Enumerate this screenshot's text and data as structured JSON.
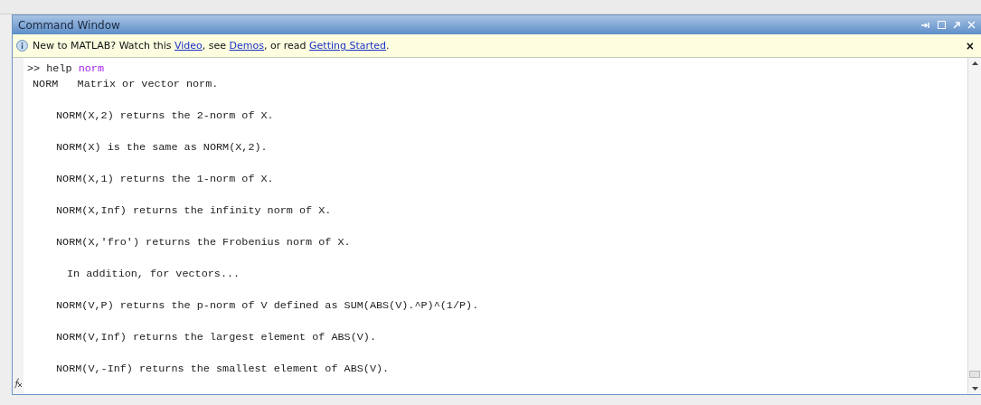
{
  "window": {
    "title": "Command Window"
  },
  "info_bar": {
    "parts": [
      {
        "kind": "text",
        "text": "New to MATLAB? Watch this "
      },
      {
        "kind": "link",
        "text": "Video"
      },
      {
        "kind": "text",
        "text": ", see "
      },
      {
        "kind": "link",
        "text": "Demos"
      },
      {
        "kind": "text",
        "text": ", or read "
      },
      {
        "kind": "link",
        "text": "Getting Started"
      },
      {
        "kind": "text",
        "text": "."
      }
    ],
    "close": "×"
  },
  "command": {
    "prompt": ">>",
    "name": "help",
    "argument": "norm"
  },
  "output": [
    {
      "kind": "heading",
      "text": "NORM   Matrix or vector norm."
    },
    {
      "kind": "body",
      "text": "NORM(X,2) returns the 2-norm of X."
    },
    {
      "kind": "body",
      "text": "NORM(X) is the same as NORM(X,2)."
    },
    {
      "kind": "body",
      "text": "NORM(X,1) returns the 1-norm of X."
    },
    {
      "kind": "body",
      "text": "NORM(X,Inf) returns the infinity norm of X."
    },
    {
      "kind": "body",
      "text": "NORM(X,'fro') returns the Frobenius norm of X."
    },
    {
      "kind": "section",
      "text": "In addition, for vectors..."
    },
    {
      "kind": "body",
      "text": "NORM(V,P) returns the p-norm of V defined as SUM(ABS(V).^P)^(1/P)."
    },
    {
      "kind": "body",
      "text": "NORM(V,Inf) returns the largest element of ABS(V)."
    },
    {
      "kind": "body",
      "text": "NORM(V,-Inf) returns the smallest element of ABS(V)."
    }
  ]
}
